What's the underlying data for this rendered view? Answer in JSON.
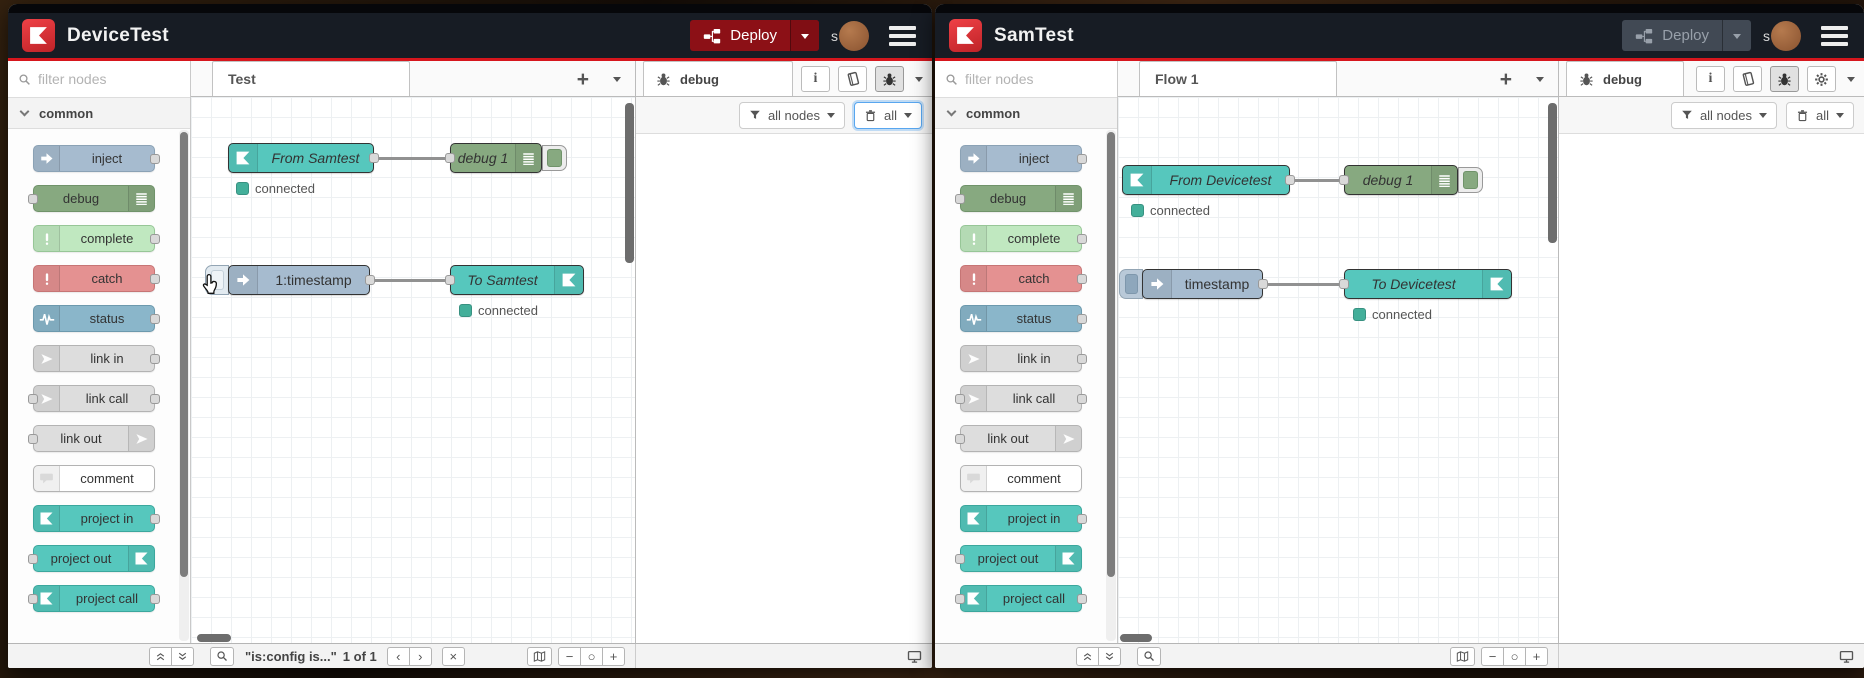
{
  "colors": {
    "header_bg": "#171c24",
    "accent_red": "#d6161d",
    "deploy_red": "#8c1016",
    "node_inject": "#a6bbcf",
    "node_debug": "#87a980",
    "node_complete": "#c0e8c0",
    "node_catch": "#e49191",
    "node_status": "#8ab6ca",
    "node_link": "#dddddd",
    "node_comment": "#ffffff",
    "node_project": "#56c7bd",
    "connected_green": "#43af9a"
  },
  "glyphs": {
    "plus": "+",
    "minus": "−",
    "zoom_reset": "○",
    "close": "×",
    "prev": "‹",
    "next": "›",
    "info": "i"
  },
  "palette": {
    "filter_placeholder": "filter nodes",
    "category": "common",
    "items": [
      {
        "label": "inject"
      },
      {
        "label": "debug"
      },
      {
        "label": "complete"
      },
      {
        "label": "catch"
      },
      {
        "label": "status"
      },
      {
        "label": "link in"
      },
      {
        "label": "link call"
      },
      {
        "label": "link out"
      },
      {
        "label": "comment"
      },
      {
        "label": "project in"
      },
      {
        "label": "project out"
      },
      {
        "label": "project call"
      }
    ]
  },
  "debug_panel": {
    "tab": "debug",
    "filter_label": "all nodes",
    "clear_label": "all"
  },
  "deploy_label": "Deploy",
  "panes": [
    {
      "title": "DeviceTest",
      "avatar": "s",
      "flow_tab": "Test",
      "nodes": {
        "flow_in": "From Samtest",
        "flow_in_status": "connected",
        "debug": "debug 1",
        "inject": "1:timestamp",
        "flow_out": "To Samtest",
        "flow_out_status": "connected"
      },
      "footer": {
        "query": "\"is:config is...\"",
        "count": "1 of 1"
      }
    },
    {
      "title": "SamTest",
      "avatar": "s",
      "flow_tab": "Flow 1",
      "nodes": {
        "flow_in": "From Devicetest",
        "flow_in_status": "connected",
        "debug": "debug 1",
        "inject": "timestamp",
        "flow_out": "To Devicetest",
        "flow_out_status": "connected"
      }
    }
  ]
}
